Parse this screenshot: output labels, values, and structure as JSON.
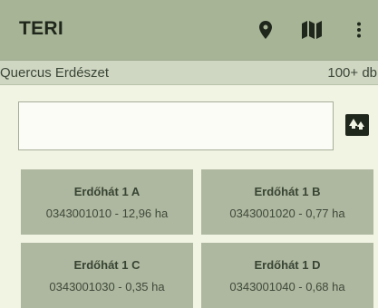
{
  "appbar": {
    "title": "TERI",
    "actions": [
      {
        "icon": "location-pin-icon"
      },
      {
        "icon": "map-icon"
      },
      {
        "icon": "more-vert-icon"
      }
    ]
  },
  "subheader": {
    "company": "Quercus Erdészet",
    "count": "100+ db"
  },
  "search": {
    "value": "",
    "placeholder": ""
  },
  "filter_button": {
    "icon": "forest-filter-icon"
  },
  "cards": [
    {
      "title": "Erdőhát 1 A",
      "subtitle": "0343001010 - 12,96 ha"
    },
    {
      "title": "Erdőhát 1 B",
      "subtitle": "0343001020 - 0,77 ha"
    },
    {
      "title": "Erdőhát 1 C",
      "subtitle": "0343001030 - 0,35 ha"
    },
    {
      "title": "Erdőhát 1 D",
      "subtitle": "0343001040 - 0,68 ha"
    }
  ],
  "colors": {
    "appbar": "#a7b496",
    "background": "#f1f3e3",
    "card": "#aeb79f",
    "dark_icon": "#1f261b"
  }
}
